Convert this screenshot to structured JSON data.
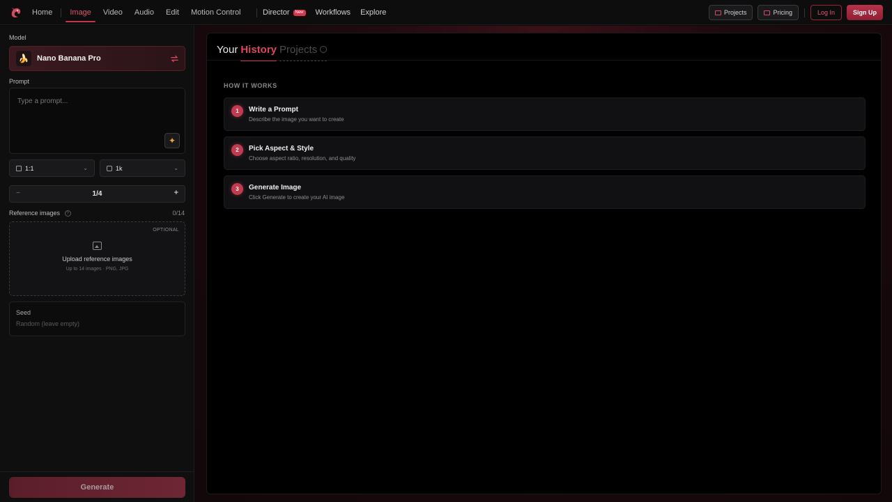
{
  "nav": {
    "items": [
      {
        "label": "Home",
        "active": false
      },
      {
        "label": "Image",
        "active": true
      },
      {
        "label": "Video",
        "active": false
      },
      {
        "label": "Audio",
        "active": false
      },
      {
        "label": "Edit",
        "active": false
      },
      {
        "label": "Motion Control",
        "active": false
      }
    ],
    "director": {
      "label": "Director",
      "badge": "New"
    },
    "workflows": "Workflows",
    "explore": "Explore",
    "projects_btn": "Projects",
    "pricing_btn": "Pricing",
    "login": "Log In",
    "signup": "Sign Up"
  },
  "left": {
    "model_label": "Model",
    "model_name": "Nano Banana Pro",
    "prompt_label": "Prompt",
    "prompt_placeholder": "Type a prompt...",
    "aspect_ratio": "1:1",
    "resolution": "1k",
    "count_display": "1/4",
    "count_value": 1,
    "count_max": 4,
    "ref_label": "Reference images",
    "ref_count": "0/14",
    "optional": "OPTIONAL",
    "upload_title": "Upload reference images",
    "upload_sub": "Up to 14 images · PNG, JPG",
    "seed_label": "Seed",
    "seed_placeholder": "Random (leave empty)",
    "generate": "Generate"
  },
  "main": {
    "your": "Your",
    "tab_history": "History",
    "tab_projects": "Projects",
    "how_it_works": "HOW IT WORKS",
    "steps": [
      {
        "num": "1",
        "title": "Write a Prompt",
        "desc": "Describe the image you want to create"
      },
      {
        "num": "2",
        "title": "Pick Aspect & Style",
        "desc": "Choose aspect ratio, resolution, and quality"
      },
      {
        "num": "3",
        "title": "Generate Image",
        "desc": "Click Generate to create your AI image"
      }
    ]
  },
  "colors": {
    "accent": "#c4364c",
    "accent_text": "#e0556a",
    "background": "#0a0a0b"
  }
}
